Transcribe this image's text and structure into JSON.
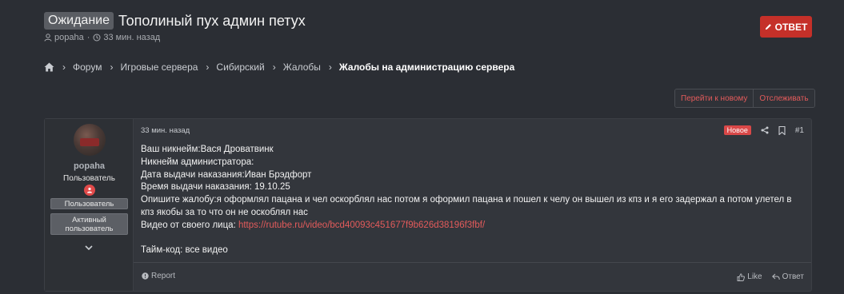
{
  "thread": {
    "prefix": "Ожидание",
    "title": "Тополиный пух админ петух",
    "author": "popaha",
    "separator": "·",
    "time_ago": "33 мин. назад"
  },
  "reply_button": {
    "label": "ОТВЕТ",
    "color": "#c53029"
  },
  "breadcrumb": [
    {
      "label": "Форум"
    },
    {
      "label": "Игровые сервера"
    },
    {
      "label": "Сибирский"
    },
    {
      "label": "Жалобы"
    },
    {
      "label": "Жалобы на администрацию сервера"
    }
  ],
  "actions": {
    "go_new": "Перейти к новому",
    "watch": "Отслеживать"
  },
  "post": {
    "user": {
      "name": "popaha",
      "title": "Пользователь",
      "banners": [
        "Пользователь",
        "Активный пользователь"
      ]
    },
    "time": "33 мин. назад",
    "new_badge": "Новое",
    "number": "#1",
    "body": {
      "l1": "Ваш никнейм:Вася Дроватвинк",
      "l2": "Никнейм администратора:",
      "l3": "Дата выдачи наказания:Иван Брэдфорт",
      "l4": "Время выдачи наказания: 19.10.25",
      "l5": "Опишите жалобу:я оформлял пацана и чел оскорблял нас потом я оформил пацана и пошел к челу он вышел из кпз и я его задержал а потом улетел в кпз якобы за то что он не оскоблял нас",
      "l6_label": "Видео от своего лица: ",
      "l6_link": "https://rutube.ru/video/bcd40093c451677f9b626d38196f3fbf/",
      "l7": "Тайм-код: все видео"
    },
    "footer": {
      "report": "Report",
      "like": "Like",
      "reply": "Ответ"
    }
  },
  "colors": {
    "accent": "#e35b5b",
    "background": "#2b2e34"
  }
}
